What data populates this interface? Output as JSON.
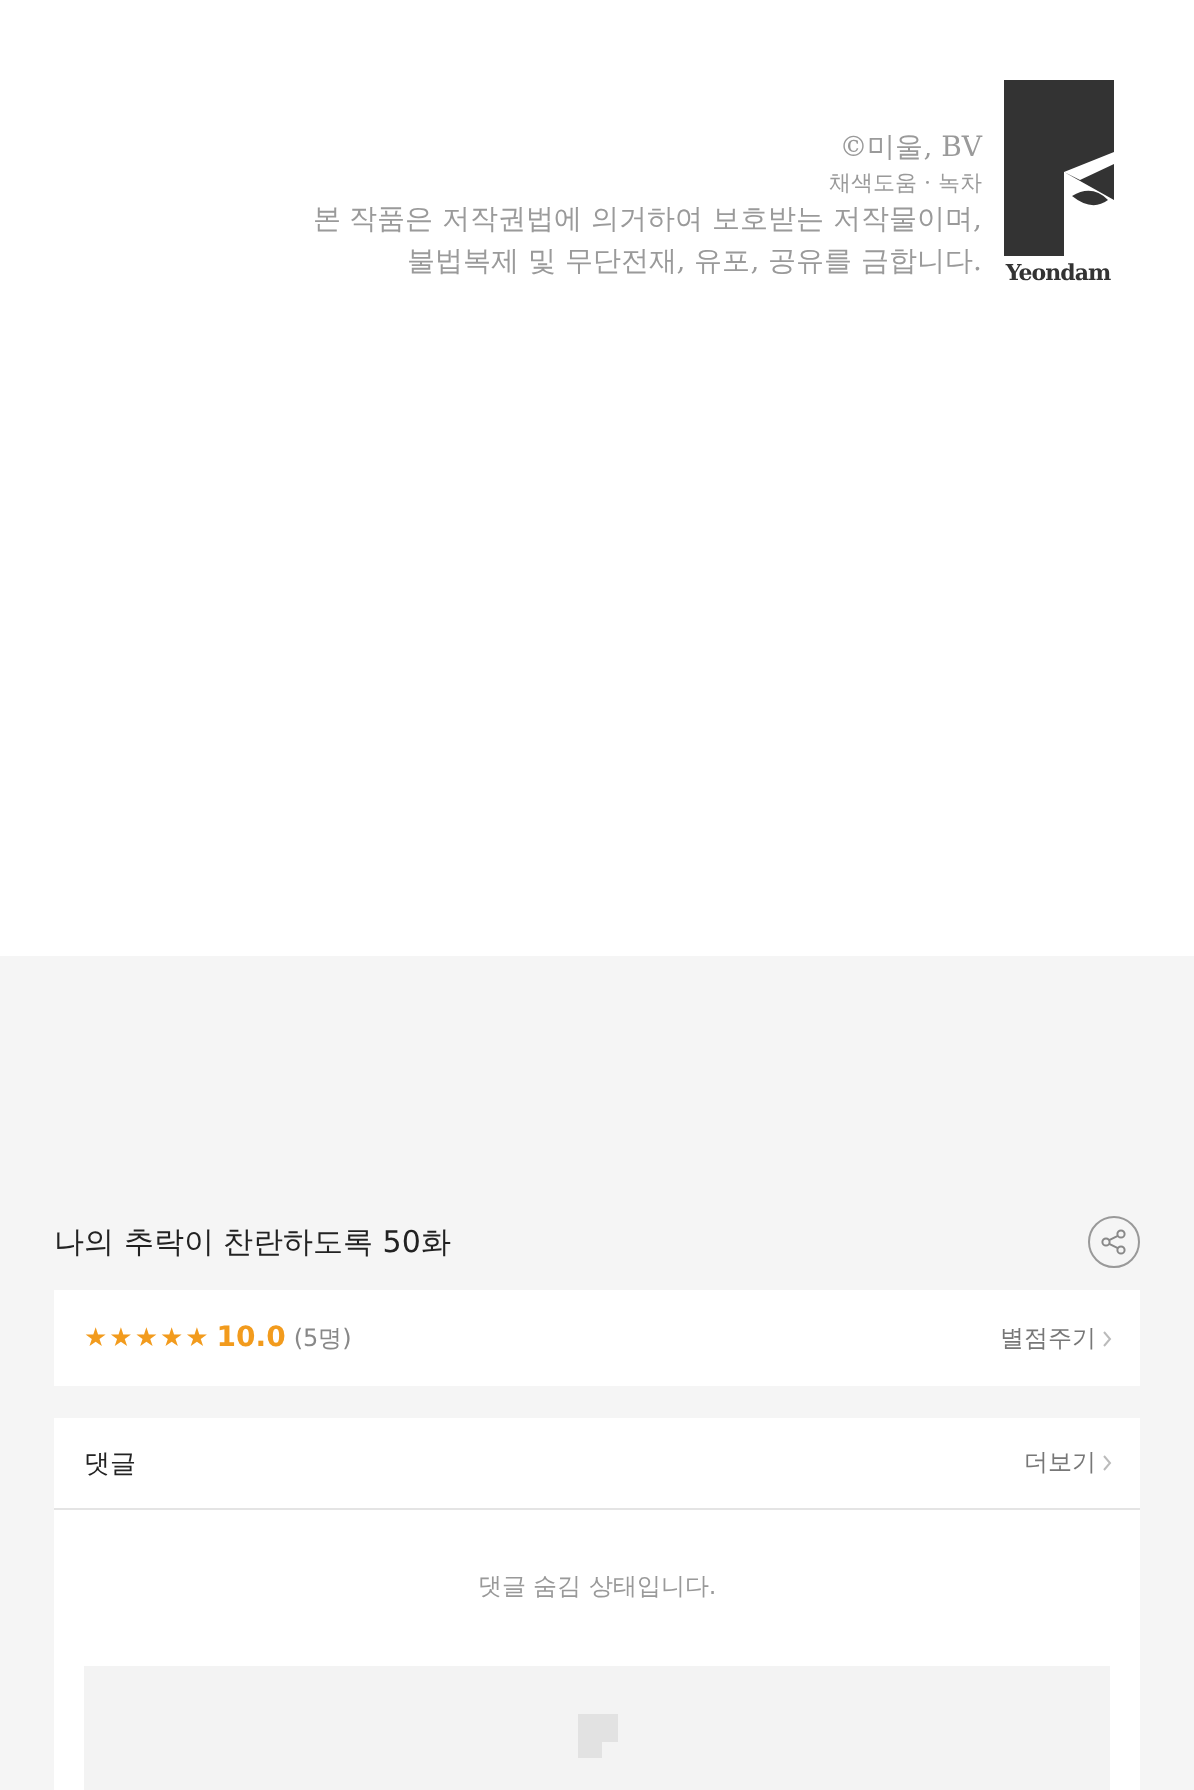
{
  "credits": {
    "copyright": "©미울, BV",
    "assist": "채색도움 · 녹차",
    "notice": [
      "본 작품은 저작권법에 의거하여 보호받는 저작물이며,",
      "불법복제 및 무단전재, 유포, 공유를 금합니다."
    ],
    "logo_text": "Yeondam"
  },
  "episode": {
    "title": "나의 추락이 찬란하도록 50화"
  },
  "rating": {
    "stars": 5,
    "score": "10.0",
    "count": "(5명)",
    "action": "별점주기"
  },
  "comments": {
    "title": "댓글",
    "more": "더보기",
    "message": "댓글 숨김 상태입니다."
  }
}
